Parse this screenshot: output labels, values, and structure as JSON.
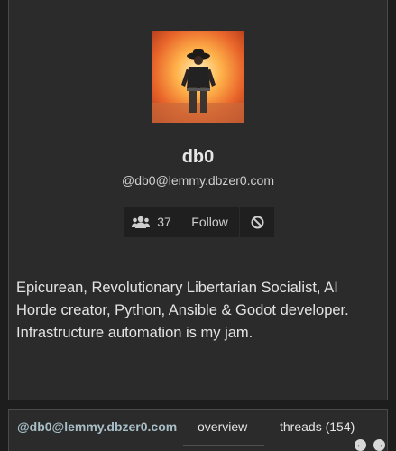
{
  "profile": {
    "username": "db0",
    "handle": "@db0@lemmy.dbzer0.com",
    "avatar_icon": "user-avatar-icon",
    "followers_count": "37",
    "follow_label": "Follow",
    "bio": "Epicurean, Revolutionary Libertarian Socialist, AI Horde creator, Python, Ansible & Godot developer. Infrastructure automation is my jam."
  },
  "tabs": {
    "handle": "@db0@lemmy.dbzer0.com",
    "items": [
      {
        "label": "overview",
        "active": true
      },
      {
        "label": "threads (154)",
        "active": false
      }
    ]
  },
  "colors": {
    "background": "#1d1d1d",
    "card": "#2b2b2b",
    "border": "#4a4a4a",
    "button": "#1f1f1f",
    "handle_link": "#a9bfc8"
  }
}
